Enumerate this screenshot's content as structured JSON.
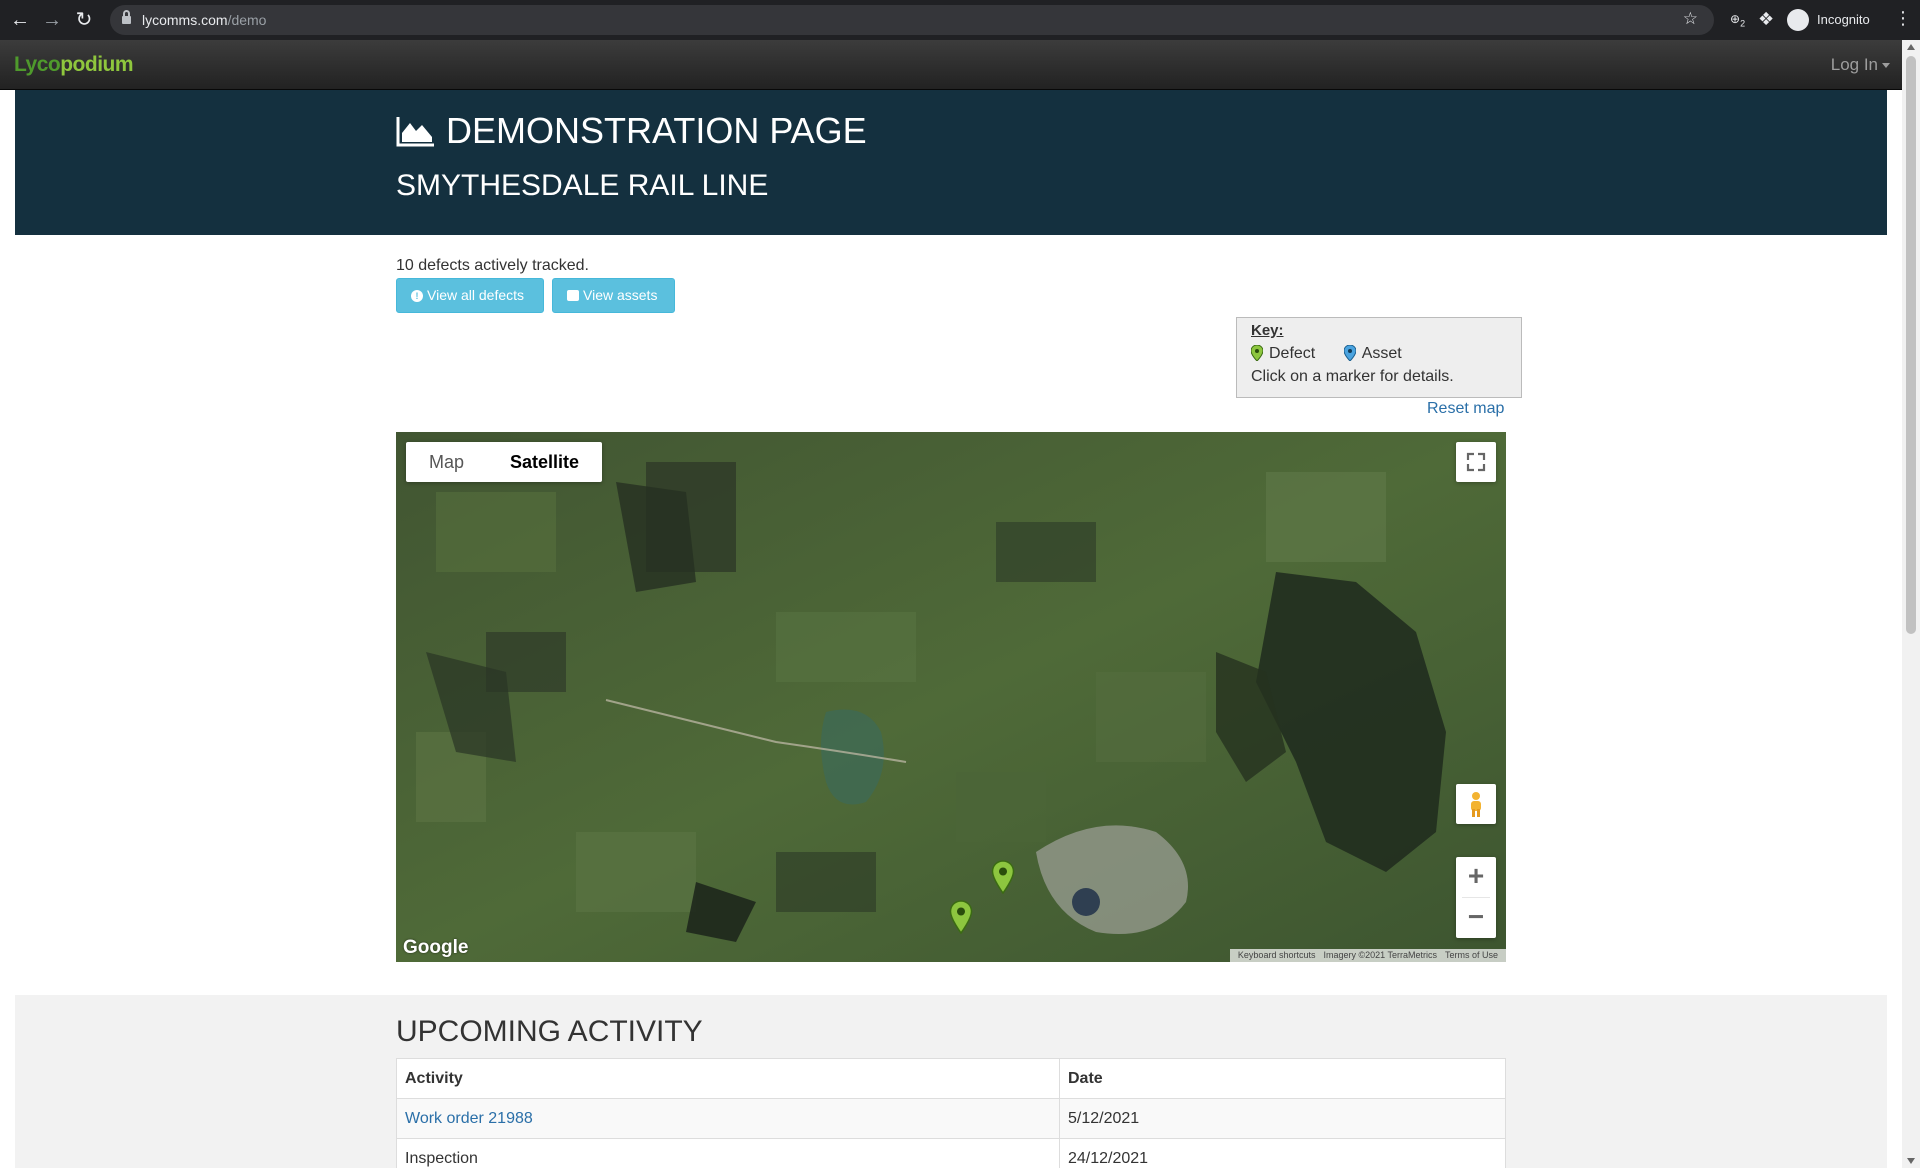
{
  "browser": {
    "url_host": "lycomms.com",
    "url_path": "/demo",
    "profile_label": "Incognito",
    "extension_badge": "2"
  },
  "navbar": {
    "brand_part1": "Lyco",
    "brand_part2": "podium",
    "login_label": "Log In"
  },
  "header": {
    "title": "DEMONSTRATION PAGE",
    "subtitle": "SMYTHESDALE RAIL LINE"
  },
  "summary": {
    "tracked_text": "10 defects actively tracked.",
    "view_defects_label": "View all defects",
    "view_assets_label": "View assets"
  },
  "key": {
    "title": "Key:",
    "defect_label": "Defect",
    "asset_label": "Asset",
    "hint": "Click on a marker for details.",
    "reset_label": "Reset map",
    "defect_color": "#8dc63f",
    "asset_color": "#4aa3df"
  },
  "map": {
    "type_tabs": [
      "Map",
      "Satellite"
    ],
    "active_tab": "Satellite",
    "google_label": "Google",
    "attribution": [
      "Keyboard shortcuts",
      "Imagery ©2021 TerraMetrics",
      "Terms of Use"
    ],
    "zoom_in_label": "+",
    "zoom_out_label": "−"
  },
  "activity": {
    "title": "UPCOMING ACTIVITY",
    "columns": [
      "Activity",
      "Date"
    ],
    "rows": [
      {
        "activity": "Work order 21988",
        "date": "5/12/2021",
        "is_link": true
      },
      {
        "activity": "Inspection",
        "date": "24/12/2021",
        "is_link": false
      }
    ]
  }
}
